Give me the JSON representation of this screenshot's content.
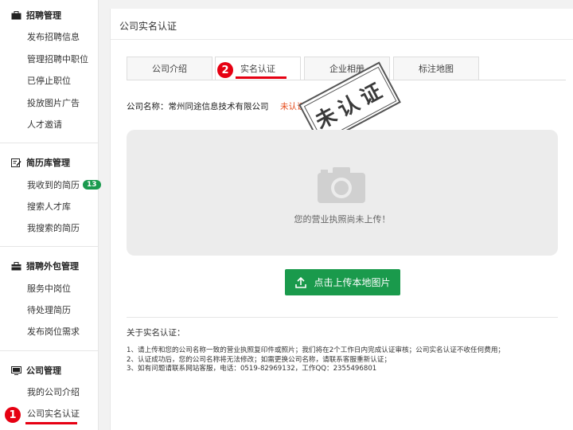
{
  "sidebar": {
    "sections": [
      {
        "title": "招聘管理",
        "icon": "briefcase-icon",
        "items": [
          "发布招聘信息",
          "管理招聘中职位",
          "已停止职位",
          "投放图片广告",
          "人才邀请"
        ]
      },
      {
        "title": "简历库管理",
        "icon": "edit-document-icon",
        "items": [
          "我收到的简历",
          "搜索人才库",
          "我搜索的简历"
        ],
        "badge": "13"
      },
      {
        "title": "猎聘外包管理",
        "icon": "suitcase-icon",
        "items": [
          "服务中岗位",
          "待处理简历",
          "发布岗位需求"
        ]
      },
      {
        "title": "公司管理",
        "icon": "monitor-icon",
        "items": [
          "我的公司介绍",
          "公司实名认证"
        ]
      }
    ],
    "marker": "1"
  },
  "main": {
    "title": "公司实名认证",
    "tabs": [
      "公司介绍",
      "实名认证",
      "企业相册",
      "标注地图"
    ],
    "active_tab": "实名认证",
    "tab_marker": "2",
    "company_label": "公司名称：常州同途信息技术有限公司",
    "status": "未认证",
    "stamp": "未认证",
    "upload_hint": "您的营业执照尚未上传！",
    "upload_button": "点击上传本地图片",
    "about_title": "关于实名认证：",
    "notes": [
      "1、请上传和您的公司名称一致的营业执照复印件或照片；我们将在2个工作日内完成认证审核；公司实名认证不收任何费用；",
      "2、认证成功后，您的公司名称将无法修改；如需更换公司名称，请联系客服重新认证；",
      "3、如有问题请联系网站客服，电话：0519-82969132，工作QQ：2355496801"
    ]
  },
  "colors": {
    "accent_green": "#1a9a4c",
    "marker_red": "#e60012",
    "status_orange": "#e64a19"
  }
}
